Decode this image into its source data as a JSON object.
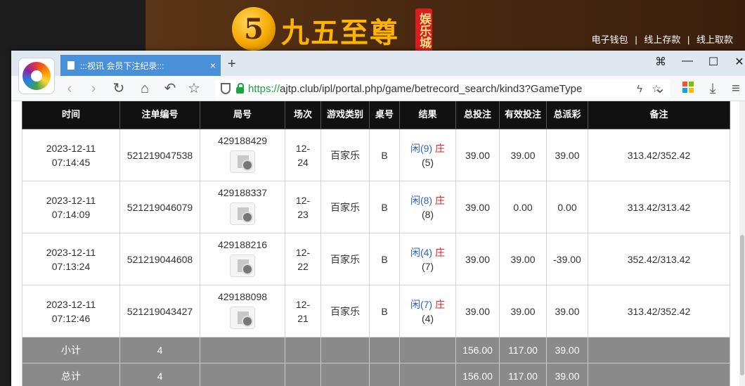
{
  "site": {
    "logo_glyph": "5",
    "logo_text": "九五至尊",
    "logo_badge": "娱乐城",
    "links": [
      "电子钱包",
      "线上存款",
      "线上取款"
    ],
    "link_separator": "|"
  },
  "browser": {
    "tab_title": ":::视讯 会员下注纪录:::",
    "tab_close": "×",
    "new_tab": "+",
    "url_scheme": "https://",
    "url_rest": "ajtp.club/ipl/portal.php/game/betrecord_search/kind3?GameType",
    "window_buttons": [
      "⌘",
      "—",
      "☐",
      "✕"
    ]
  },
  "table": {
    "headers": [
      "时间",
      "注单编号",
      "局号",
      "场次",
      "游戏类别",
      "桌号",
      "结果",
      "总投注",
      "有效投注",
      "总派彩",
      "备注"
    ],
    "rows": [
      {
        "time_date": "2023-12-11",
        "time_clock": "07:14:45",
        "order_no": "521219047538",
        "round_no": "429188429",
        "session_a": "12-",
        "session_b": "24",
        "game": "百家乐",
        "table": "B",
        "player": "闲(9)",
        "banker": "庄",
        "banker_val": "(5)",
        "total_bet": "39.00",
        "valid_bet": "39.00",
        "payout": "39.00",
        "remark": "313.42/352.42"
      },
      {
        "time_date": "2023-12-11",
        "time_clock": "07:14:09",
        "order_no": "521219046079",
        "round_no": "429188337",
        "session_a": "12-",
        "session_b": "23",
        "game": "百家乐",
        "table": "B",
        "player": "闲(8)",
        "banker": "庄",
        "banker_val": "(8)",
        "total_bet": "39.00",
        "valid_bet": "0.00",
        "payout": "0.00",
        "remark": "313.42/313.42"
      },
      {
        "time_date": "2023-12-11",
        "time_clock": "07:13:24",
        "order_no": "521219044608",
        "round_no": "429188216",
        "session_a": "12-",
        "session_b": "22",
        "game": "百家乐",
        "table": "B",
        "player": "闲(4)",
        "banker": "庄",
        "banker_val": "(7)",
        "total_bet": "39.00",
        "valid_bet": "39.00",
        "payout": "-39.00",
        "remark": "352.42/313.42"
      },
      {
        "time_date": "2023-12-11",
        "time_clock": "07:12:46",
        "order_no": "521219043427",
        "round_no": "429188098",
        "session_a": "12-",
        "session_b": "21",
        "game": "百家乐",
        "table": "B",
        "player": "闲(7)",
        "banker": "庄",
        "banker_val": "(4)",
        "total_bet": "39.00",
        "valid_bet": "39.00",
        "payout": "39.00",
        "remark": "313.42/352.42"
      }
    ],
    "subtotal": {
      "label": "小计",
      "count": "4",
      "total_bet": "156.00",
      "valid_bet": "117.00",
      "payout": "39.00"
    },
    "total": {
      "label": "总计",
      "count": "4",
      "total_bet": "156.00",
      "valid_bet": "117.00",
      "payout": "39.00"
    }
  },
  "colors": {
    "accent_blue": "#2a62c9",
    "loss_red": "#dd2222",
    "header_black": "#111111",
    "summary_gray": "#8a8a8a"
  }
}
